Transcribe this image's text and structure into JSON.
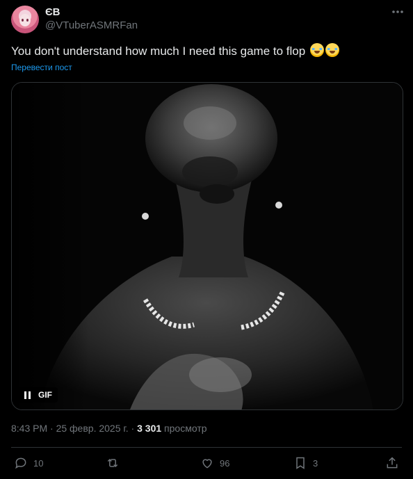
{
  "author": {
    "display_name": "ЄВ",
    "handle": "@VTuberASMRFan"
  },
  "icons": {
    "avatar": "anime-girl-avatar",
    "more": "more-icon",
    "pause": "pause-icon",
    "emoji": "loudly-crying-face-emoji"
  },
  "tweet": {
    "text": "You don't understand how much I need this game to flop",
    "translate_label": "Перевести пост",
    "media_type_label": "GIF",
    "timestamp": "8:43 PM · 25 февр. 2025 г. · ",
    "views_count": "3 301",
    "views_label": " просмотр"
  },
  "actions": {
    "replies": "10",
    "reposts": "",
    "likes": "96",
    "bookmarks": "3"
  },
  "colors": {
    "background": "#000000",
    "text": "#e7e9ea",
    "secondary": "#71767b",
    "link": "#1d9bf0"
  }
}
